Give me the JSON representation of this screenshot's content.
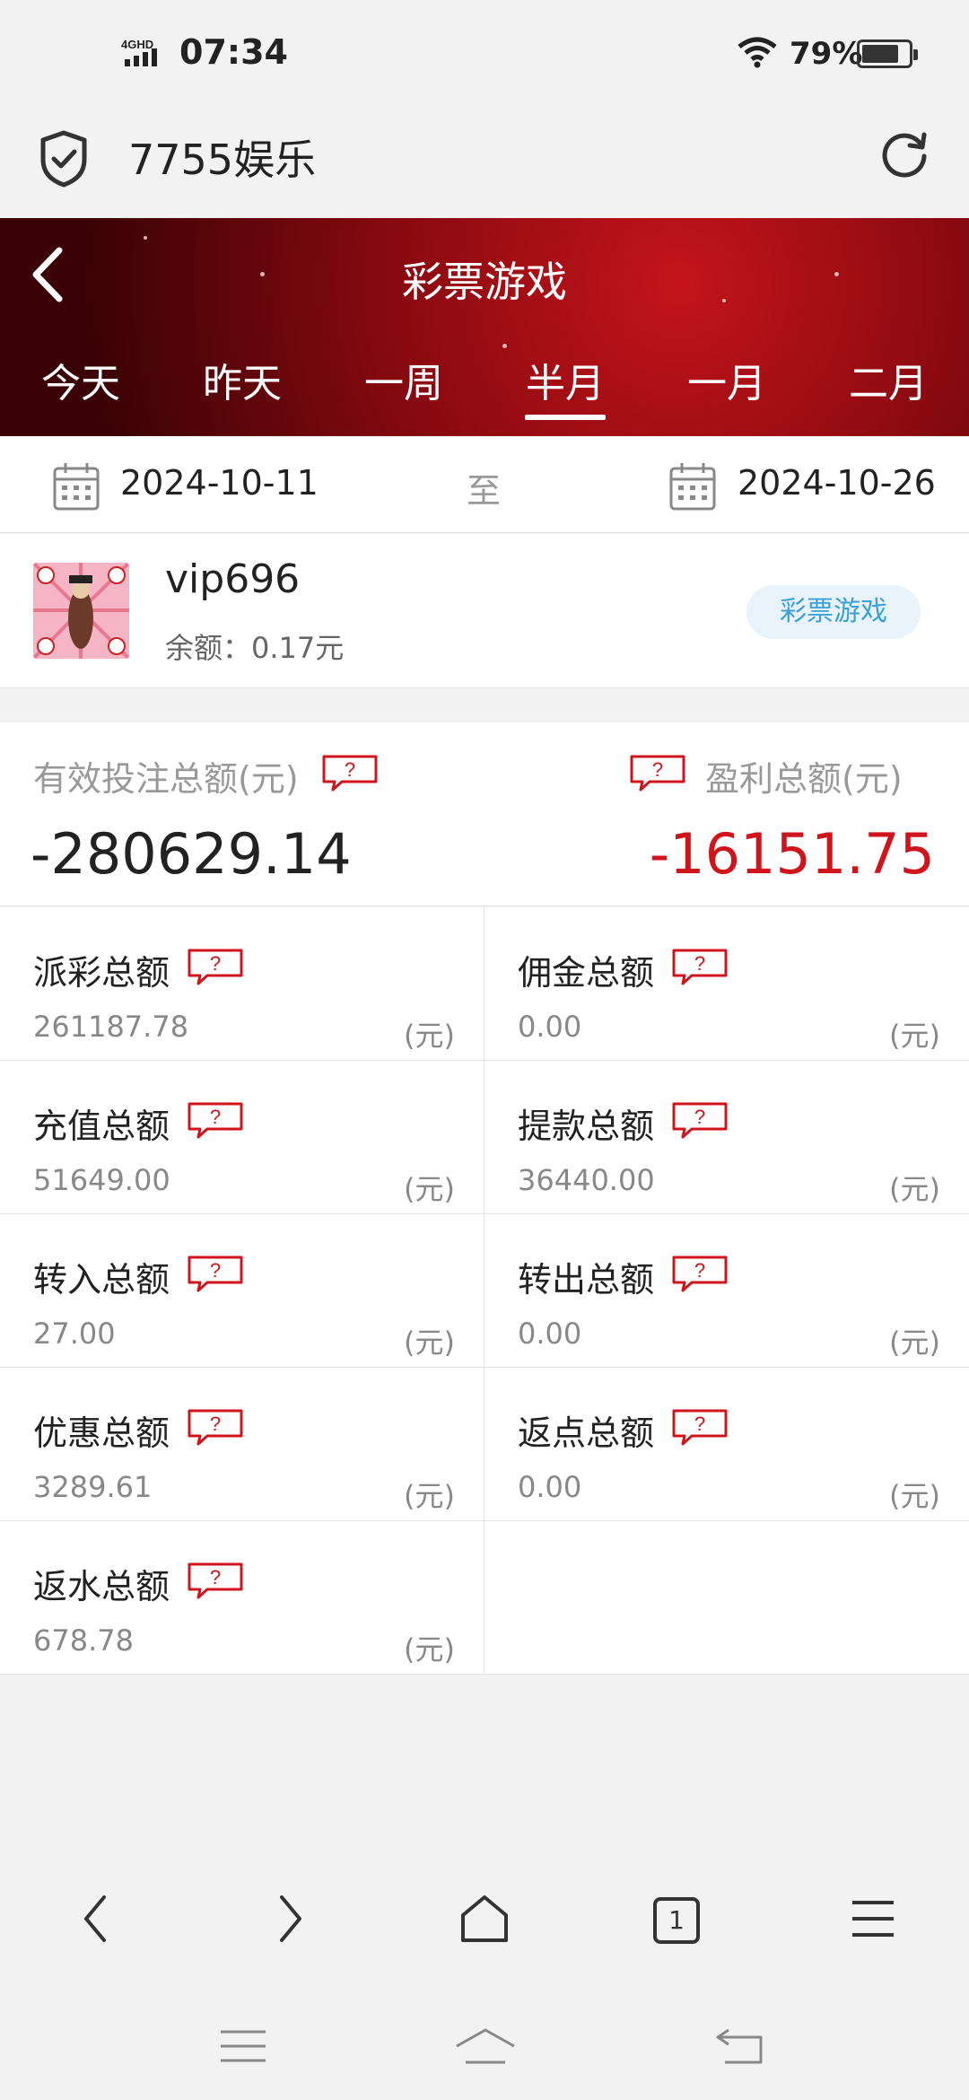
{
  "status_bar": {
    "network": "4G HD",
    "time": "07:34",
    "battery_percent": "79%",
    "battery_level": 0.79
  },
  "browser": {
    "site_title": "7755娱乐"
  },
  "header": {
    "title": "彩票游戏",
    "tabs": [
      "今天",
      "昨天",
      "一周",
      "半月",
      "一月",
      "二月"
    ],
    "active_tab": "半月"
  },
  "date_range": {
    "start": "2024-10-11",
    "separator": "至",
    "end": "2024-10-26"
  },
  "user": {
    "username": "vip696",
    "balance": "余额：0.17元",
    "game_badge": "彩票游戏"
  },
  "summary": {
    "bet_label": "有效投注总额(元)",
    "bet_value": "-280629.14",
    "profit_label": "盈利总额(元)",
    "profit_value": "-16151.75",
    "profit_color": "#d0141c"
  },
  "stats": [
    {
      "label": "派彩总额",
      "value": "261187.78",
      "unit": "(元)"
    },
    {
      "label": "佣金总额",
      "value": "0.00",
      "unit": "(元)"
    },
    {
      "label": "充值总额",
      "value": "51649.00",
      "unit": "(元)"
    },
    {
      "label": "提款总额",
      "value": "36440.00",
      "unit": "(元)"
    },
    {
      "label": "转入总额",
      "value": "27.00",
      "unit": "(元)"
    },
    {
      "label": "转出总额",
      "value": "0.00",
      "unit": "(元)"
    },
    {
      "label": "优惠总额",
      "value": "3289.61",
      "unit": "(元)"
    },
    {
      "label": "返点总额",
      "value": "0.00",
      "unit": "(元)"
    },
    {
      "label": "返水总额",
      "value": "678.78",
      "unit": "(元)"
    }
  ],
  "bottom_nav": {
    "tab_count": "1"
  },
  "icons": {
    "back": "chevron-left-icon",
    "forward": "chevron-right-icon",
    "home": "home-icon",
    "tabs": "tabs-icon",
    "menu": "menu-icon",
    "reload": "reload-icon",
    "shield": "shield-check-icon",
    "calendar": "calendar-icon",
    "help": "question-bubble-icon"
  }
}
